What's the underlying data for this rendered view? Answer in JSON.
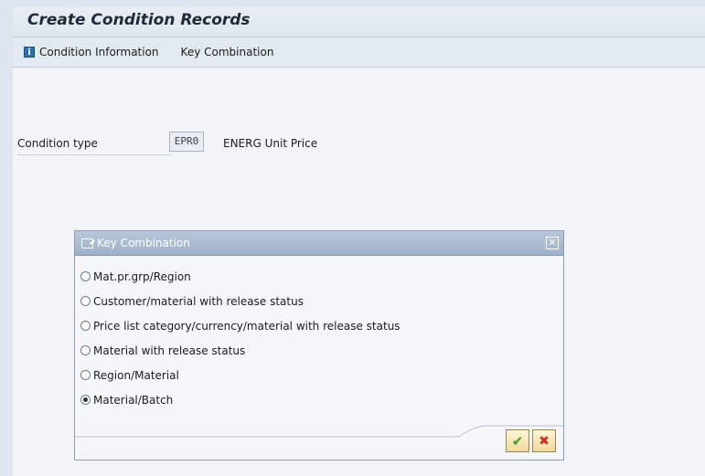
{
  "window": {
    "title": "Create Condition Records"
  },
  "toolbar": {
    "items": [
      {
        "label": "Condition Information",
        "icon": "info-icon"
      },
      {
        "label": "Key Combination"
      }
    ]
  },
  "form": {
    "condition_type": {
      "label": "Condition type",
      "value": "EPR0",
      "description": "ENERG Unit Price"
    }
  },
  "dialog": {
    "title": "Key Combination",
    "options": [
      {
        "label": "Mat.pr.grp/Region",
        "selected": false
      },
      {
        "label": "Customer/material with release status",
        "selected": false
      },
      {
        "label": "Price list category/currency/material with release status",
        "selected": false
      },
      {
        "label": "Material with release status",
        "selected": false
      },
      {
        "label": "Region/Material",
        "selected": false
      },
      {
        "label": "Material/Batch",
        "selected": true
      }
    ],
    "buttons": {
      "ok_icon": "checkmark-icon",
      "cancel_icon": "cancel-x-icon"
    }
  },
  "colors": {
    "ok": "#3e9b22",
    "cancel": "#c8321f",
    "dialog_header": "#a8b9cf"
  }
}
